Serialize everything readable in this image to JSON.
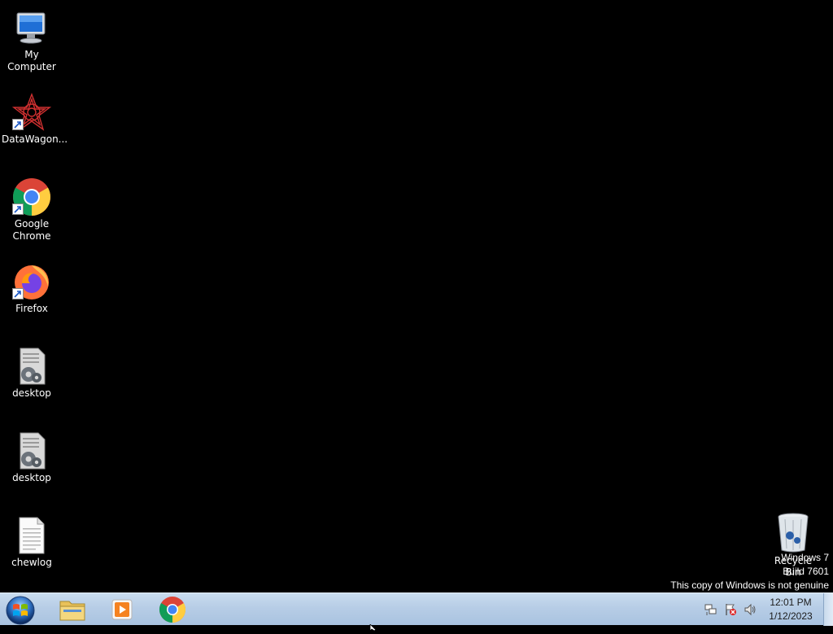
{
  "desktop_icons": [
    {
      "label": "My Computer",
      "icon": "computer-icon",
      "shortcut": false
    },
    {
      "label": "DataWagon...",
      "icon": "datawagon-icon",
      "shortcut": true
    },
    {
      "label": "Google\nChrome",
      "icon": "chrome-icon",
      "shortcut": true
    },
    {
      "label": "Firefox",
      "icon": "firefox-icon",
      "shortcut": true
    },
    {
      "label": "desktop",
      "icon": "settings-file-icon",
      "shortcut": false
    },
    {
      "label": "desktop",
      "icon": "settings-file-icon",
      "shortcut": false
    },
    {
      "label": "chewlog",
      "icon": "text-file-icon",
      "shortcut": false
    }
  ],
  "recycle_bin": {
    "label": "Recycle Bin",
    "icon": "recycle-bin-icon"
  },
  "watermark": {
    "line1": "Windows 7",
    "line2": "Build 7601",
    "line3": "This copy of Windows is not genuine"
  },
  "taskbar": {
    "start": "start-orb-icon",
    "pinned": [
      "folder-icon",
      "media-player-icon",
      "chrome-icon"
    ],
    "tray_icons": [
      "network-icon",
      "action-center-flag-icon",
      "volume-icon"
    ],
    "clock": {
      "time": "12:01 PM",
      "date": "1/12/2023"
    }
  }
}
